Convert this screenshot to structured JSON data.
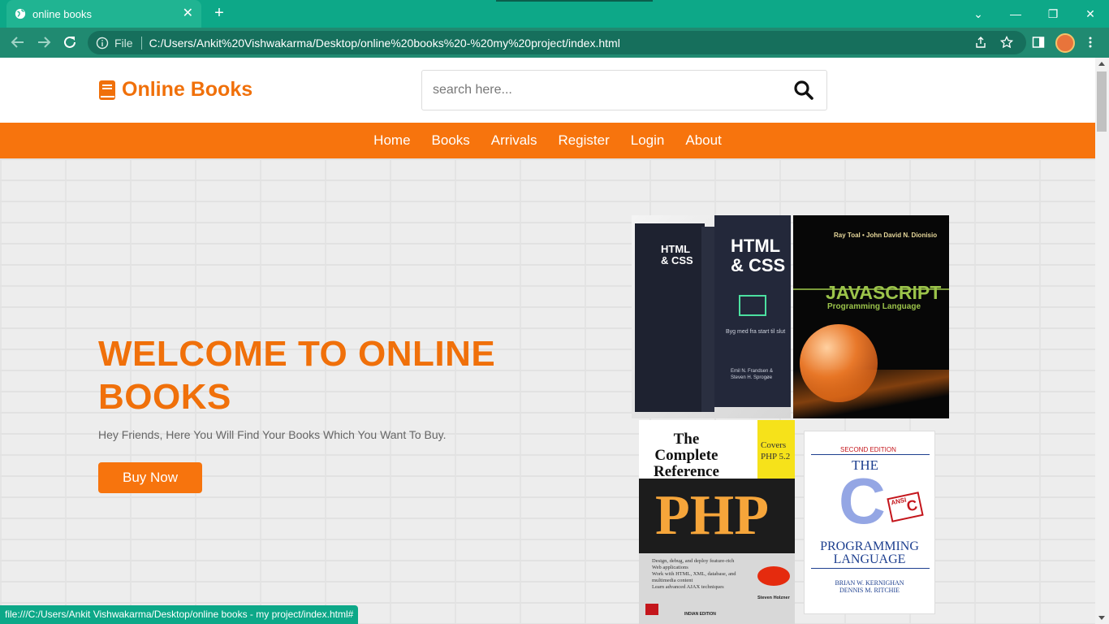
{
  "browser": {
    "tab_title": "online books",
    "new_tab": "+",
    "url_label": "File",
    "url": "C:/Users/Ankit%20Vishwakarma/Desktop/online%20books%20-%20my%20project/index.html",
    "status_url": "file:///C:/Users/Ankit Vishwakarma/Desktop/online books - my project/index.html#"
  },
  "header": {
    "logo_text": "Online Books",
    "search_placeholder": "search here..."
  },
  "nav": {
    "items": [
      "Home",
      "Books",
      "Arrivals",
      "Register",
      "Login",
      "About"
    ]
  },
  "hero": {
    "title": "WELCOME TO ONLINE BOOKS",
    "text": "Hey Friends, Here You Will Find Your Books Which You Want To Buy.",
    "button": "Buy Now"
  },
  "books": {
    "html": {
      "title1": "HTML",
      "title2": "& CSS",
      "tagline": "Byg med fra start til slut",
      "authors1": "Emil N. Frandsen &",
      "authors2": "Steven H. Sprogøe"
    },
    "js": {
      "authors": "Ray Toal • John David N. Dionisio",
      "title": "JAVASCRIPT",
      "subtitle": "Programming Language"
    },
    "php": {
      "title1": "The",
      "title2": "Complete",
      "title3": "Reference",
      "covers": "Covers",
      "version": "PHP 5.2",
      "big": "PHP",
      "bullet1": "Design, debug, and deploy feature-rich",
      "bullet1b": "Web applications",
      "bullet2": "Work with HTML, XML, database, and",
      "bullet2b": "multimedia content",
      "bullet3": "Learn advanced AJAX techniques",
      "edition": "INDIAN EDITION",
      "author": "Steven Holzner"
    },
    "c": {
      "edition": "SECOND EDITION",
      "the": "THE",
      "letter": "C",
      "ansi": "ANSI",
      "ansi_c": "C",
      "title1": "PROGRAMMING",
      "title2": "LANGUAGE",
      "author1": "BRIAN W. KERNIGHAN",
      "author2": "DENNIS M. RITCHIE"
    }
  },
  "colors": {
    "accent": "#f7740d",
    "brand_text": "#f0700a",
    "browser": "#0da888"
  }
}
